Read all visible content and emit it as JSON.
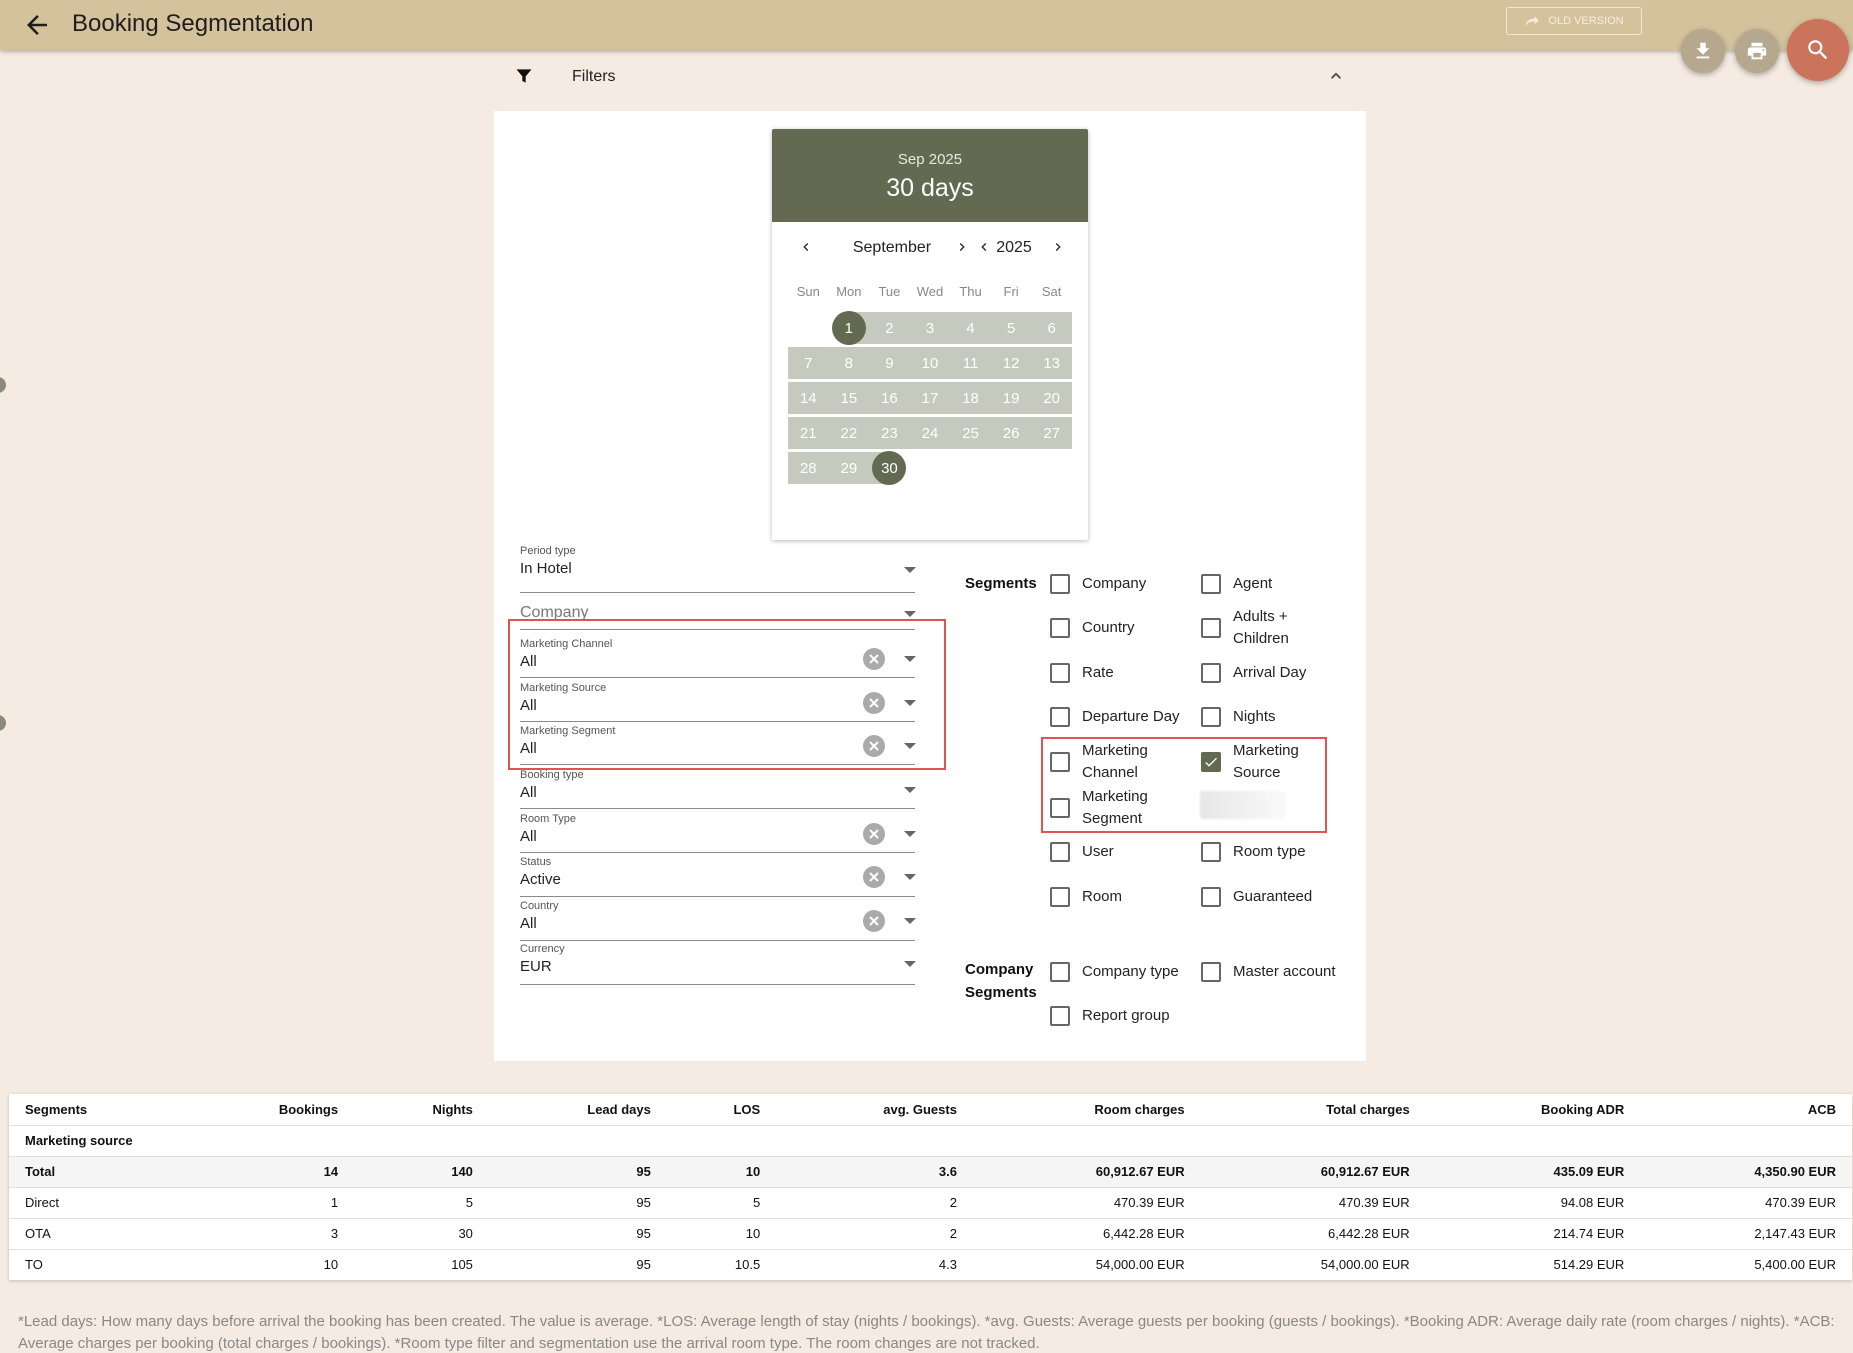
{
  "header": {
    "title": "Booking Segmentation",
    "old_version_label": "OLD VERSION"
  },
  "filters_bar": {
    "label": "Filters"
  },
  "calendar": {
    "header_sub": "Sep 2025",
    "header_main": "30 days",
    "month": "September",
    "year": "2025",
    "weekdays": [
      "Sun",
      "Mon",
      "Tue",
      "Wed",
      "Thu",
      "Fri",
      "Sat"
    ],
    "days": [
      "1",
      "2",
      "3",
      "4",
      "5",
      "6",
      "7",
      "8",
      "9",
      "10",
      "11",
      "12",
      "13",
      "14",
      "15",
      "16",
      "17",
      "18",
      "19",
      "20",
      "21",
      "22",
      "23",
      "24",
      "25",
      "26",
      "27",
      "28",
      "29",
      "30"
    ],
    "first_weekday_index": 1,
    "range_start": "1",
    "range_end": "30"
  },
  "form": {
    "period_type": {
      "label": "Period type",
      "value": "In Hotel"
    },
    "company": {
      "placeholder": "Company"
    },
    "marketing_channel": {
      "label": "Marketing Channel",
      "value": "All"
    },
    "marketing_source": {
      "label": "Marketing Source",
      "value": "All"
    },
    "marketing_segment": {
      "label": "Marketing Segment",
      "value": "All"
    },
    "booking_type": {
      "label": "Booking type",
      "value": "All"
    },
    "room_type": {
      "label": "Room Type",
      "value": "All"
    },
    "status": {
      "label": "Status",
      "value": "Active"
    },
    "country": {
      "label": "Country",
      "value": "All"
    },
    "currency": {
      "label": "Currency",
      "value": "EUR"
    }
  },
  "segments": {
    "title": "Segments",
    "items": [
      {
        "label": "Company",
        "checked": false
      },
      {
        "label": "Agent",
        "checked": false
      },
      {
        "label": "Country",
        "checked": false
      },
      {
        "label": "Adults + Children",
        "checked": false
      },
      {
        "label": "Rate",
        "checked": false
      },
      {
        "label": "Arrival Day",
        "checked": false
      },
      {
        "label": "Departure Day",
        "checked": false
      },
      {
        "label": "Nights",
        "checked": false
      },
      {
        "label": "Marketing Channel",
        "checked": false
      },
      {
        "label": "Marketing Source",
        "checked": true
      },
      {
        "label": "Marketing Segment",
        "checked": false
      },
      {
        "label": "User",
        "checked": false
      },
      {
        "label": "Room type",
        "checked": false
      },
      {
        "label": "Room",
        "checked": false
      },
      {
        "label": "Guaranteed",
        "checked": false
      }
    ]
  },
  "company_segments": {
    "title_line1": "Company",
    "title_line2": "Segments",
    "items": [
      {
        "label": "Company type",
        "checked": false
      },
      {
        "label": "Master account",
        "checked": false
      },
      {
        "label": "Report group",
        "checked": false
      }
    ]
  },
  "table": {
    "columns": [
      "Segments",
      "Bookings",
      "Nights",
      "Lead days",
      "LOS",
      "avg. Guests",
      "Room charges",
      "Total charges",
      "Booking ADR",
      "ACB"
    ],
    "group_label": "Marketing source",
    "total": [
      "Total",
      "14",
      "140",
      "95",
      "10",
      "3.6",
      "60,912.67 EUR",
      "60,912.67 EUR",
      "435.09 EUR",
      "4,350.90 EUR"
    ],
    "rows": [
      [
        "Direct",
        "1",
        "5",
        "95",
        "5",
        "2",
        "470.39 EUR",
        "470.39 EUR",
        "94.08 EUR",
        "470.39 EUR"
      ],
      [
        "OTA",
        "3",
        "30",
        "95",
        "10",
        "2",
        "6,442.28 EUR",
        "6,442.28 EUR",
        "214.74 EUR",
        "2,147.43 EUR"
      ],
      [
        "TO",
        "10",
        "105",
        "95",
        "10.5",
        "4.3",
        "54,000.00 EUR",
        "54,000.00 EUR",
        "514.29 EUR",
        "5,400.00 EUR"
      ]
    ]
  },
  "footnote": "*Lead days: How many days before arrival the booking has been created. The value is average. *LOS: Average length of stay (nights / bookings). *avg. Guests: Average guests per booking (guests / bookings). *Booking ADR: Average daily rate (room charges / nights). *ACB: Average charges per booking (total charges / bookings). *Room type filter and segmentation use the arrival room type. The room changes are not tracked.",
  "colors": {
    "topbar": "#d4c29c",
    "background": "#f5ebe2",
    "accent": "#636a51",
    "search_fab": "#c9745b",
    "highlight": "#e05353"
  }
}
